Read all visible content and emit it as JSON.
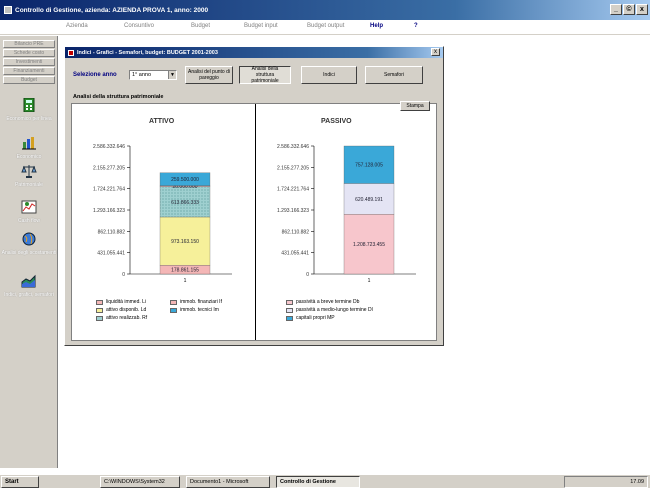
{
  "window": {
    "title": "Controllo di Gestione, azienda: AZIENDA PROVA 1, anno: 2000",
    "min": "_",
    "max": "©",
    "close": "x"
  },
  "menu": [
    {
      "label": "Azienda"
    },
    {
      "label": "Consuntivo"
    },
    {
      "label": "Budget"
    },
    {
      "label": "Budget input"
    },
    {
      "label": "Budget output"
    },
    {
      "label": "Help"
    },
    {
      "label": "?"
    }
  ],
  "sidebar": {
    "buttons": [
      "Bilancio PRE",
      "Schede costo",
      "Investimenti",
      "Finanziamenti",
      "Budget"
    ],
    "tools": [
      {
        "label": "Economico per linea",
        "icon": "calculator-icon"
      },
      {
        "label": "Economico",
        "icon": "bar-chart-icon"
      },
      {
        "label": "Patrimoniale",
        "icon": "scale-icon"
      },
      {
        "label": "Cash flow",
        "icon": "cash-flow-icon"
      },
      {
        "label": "Analisi degli scostamenti",
        "icon": "globe-icon"
      },
      {
        "label": "Indici, grafici, semafori",
        "icon": "chart-area-icon"
      }
    ]
  },
  "dialog": {
    "title": "Indici - Grafici - Semafori, budget: BUDGET 2001-2003",
    "close": "x",
    "select_label": "Selezione anno",
    "select_value": "1° anno",
    "buttons": [
      {
        "label": "Analisi del punto di pareggio"
      },
      {
        "label": "Analisi della struttura patrimoniale"
      },
      {
        "label": "Indici"
      },
      {
        "label": "Semafori"
      }
    ],
    "panel_title": "Analisi della struttura patrimoniale",
    "print": "Stampa"
  },
  "chart_data": [
    {
      "type": "bar",
      "stacked": true,
      "title": "ATTIVO",
      "categories": [
        "1"
      ],
      "yticks": [
        "0",
        "431.055.441",
        "862.110.882",
        "1.293.166.323",
        "1.724.221.764",
        "2.155.277.205",
        "2.586.332.646"
      ],
      "ylim": [
        0,
        2586332646
      ],
      "series": [
        {
          "name": "liquidità immed. Li",
          "values": [
            178861155
          ],
          "label": "178.861.155",
          "color": "#f4b6b6"
        },
        {
          "name": "attivo disponib. Ld",
          "values": [
            973163150
          ],
          "label": "973.163.150",
          "color": "#f6f09a"
        },
        {
          "name": "attivo realizzab. Rf",
          "values": [
            613866333
          ],
          "label": "613.866.333",
          "color": "#9fd0d0",
          "pattern": true
        },
        {
          "name": "immob. finanziari If",
          "values": [
            20000000
          ],
          "label": "20.000.000",
          "color": "#f4b6b6"
        },
        {
          "name": "immob. tecnici Im",
          "values": [
            259500000
          ],
          "label": "259.500.000",
          "color": "#3aa8d8"
        }
      ]
    },
    {
      "type": "bar",
      "stacked": true,
      "title": "PASSIVO",
      "categories": [
        "1"
      ],
      "yticks": [
        "0",
        "431.055.441",
        "862.110.882",
        "1.293.166.323",
        "1.724.221.764",
        "2.155.277.205",
        "2.586.332.646"
      ],
      "ylim": [
        0,
        2586332646
      ],
      "series": [
        {
          "name": "passività a breve termine Db",
          "values": [
            1208723455
          ],
          "label": "1.208.723.455",
          "color": "#f7c6cc"
        },
        {
          "name": "passività a medio-lungo termine Dl",
          "values": [
            620489191
          ],
          "label": "620.489.191",
          "color": "#e4e4f4"
        },
        {
          "name": "capitali propri MP",
          "values": [
            757128005
          ],
          "label": "757.128.005",
          "color": "#3aa8d8"
        }
      ]
    }
  ],
  "taskbar": {
    "start": "Start",
    "tasks": [
      {
        "label": "C:\\WINDOWS\\System32"
      },
      {
        "label": "Documento1 - Microsoft"
      },
      {
        "label": "Controllo di Gestione"
      }
    ],
    "clock": "17.09"
  }
}
